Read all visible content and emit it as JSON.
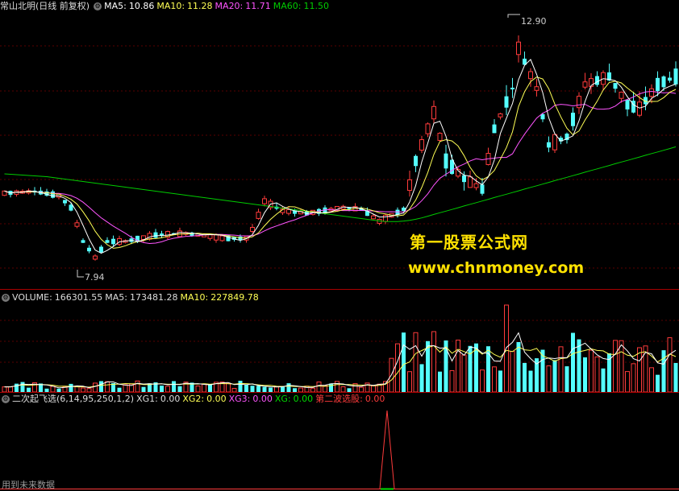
{
  "main": {
    "title": "常山北明(日线 前复权)",
    "ma5_label": "MA5:",
    "ma5": "10.86",
    "ma10_label": "MA10:",
    "ma10": "11.28",
    "ma20_label": "MA20:",
    "ma20": "11.71",
    "ma60_label": "MA60:",
    "ma60": "11.50",
    "high_label": "12.90",
    "low_label": "7.94",
    "colors": {
      "up": "#ff3b3b",
      "down": "#54ffff",
      "ma5": "#ffffff",
      "ma10": "#ffff55",
      "ma20": "#ff55ff",
      "ma60": "#00cc00"
    }
  },
  "volume": {
    "label": "VOLUME:",
    "value": "166301.55",
    "ma5_label": "MA5:",
    "ma5": "173481.28",
    "ma10_label": "MA10:",
    "ma10": "227849.78"
  },
  "indicator": {
    "title": "二次起飞选(6,14,95,250,1,2)",
    "xg1_label": "XG1:",
    "xg1": "0.00",
    "xg2_label": "XG2:",
    "xg2": "0.00",
    "xg3_label": "XG3:",
    "xg3": "0.00",
    "xg_label": "XG:",
    "xg": "0.00",
    "second_wave_label": "第二波选股:",
    "second_wave": "0.00"
  },
  "watermark": {
    "title": "第一股票公式网",
    "url": "www.chnmoney.com"
  },
  "footer_note": "用到未来数据"
}
